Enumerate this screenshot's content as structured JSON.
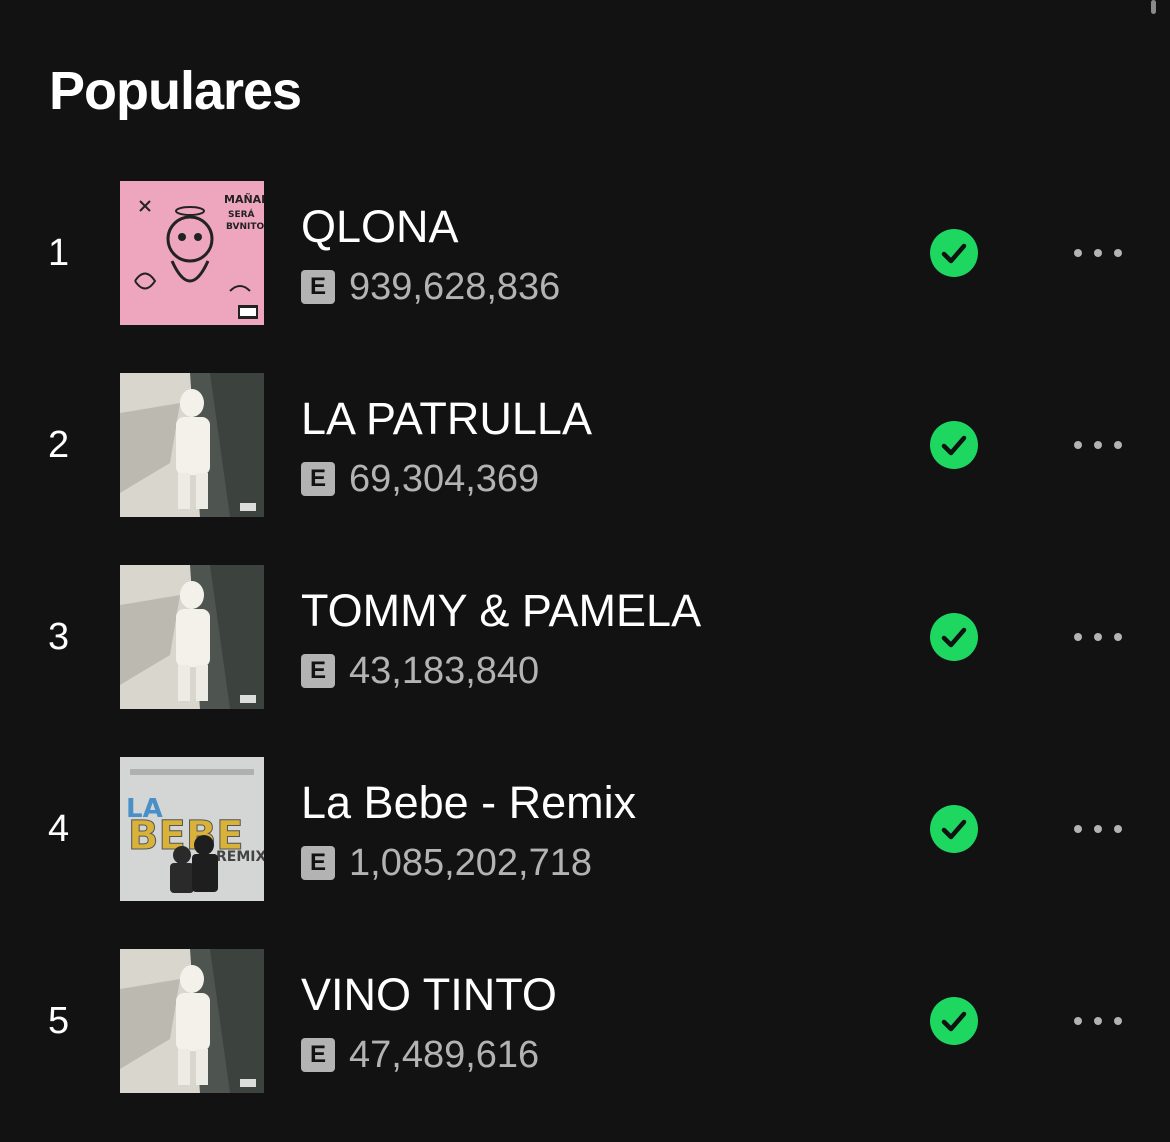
{
  "section": {
    "title": "Populares"
  },
  "tracks": [
    {
      "rank": "1",
      "title": "QLONA",
      "explicit_label": "E",
      "plays": "939,628,836",
      "cover": "pink-doodle-cover",
      "saved": true
    },
    {
      "rank": "2",
      "title": "LA PATRULLA",
      "explicit_label": "E",
      "plays": "69,304,369",
      "cover": "grayscale-figure-cover",
      "saved": true
    },
    {
      "rank": "3",
      "title": "TOMMY & PAMELA",
      "explicit_label": "E",
      "plays": "43,183,840",
      "cover": "grayscale-figure-cover",
      "saved": true
    },
    {
      "rank": "4",
      "title": "La Bebe - Remix",
      "explicit_label": "E",
      "plays": "1,085,202,718",
      "cover": "balloon-letters-cover",
      "saved": true
    },
    {
      "rank": "5",
      "title": "VINO TINTO",
      "explicit_label": "E",
      "plays": "47,489,616",
      "cover": "grayscale-figure-cover",
      "saved": true
    }
  ],
  "colors": {
    "background": "#121212",
    "accent_green": "#1ed760",
    "secondary_text": "#b3b3b3"
  },
  "icons": {
    "saved": "check-circle-icon",
    "more": "more-options-icon",
    "explicit": "explicit-badge"
  }
}
